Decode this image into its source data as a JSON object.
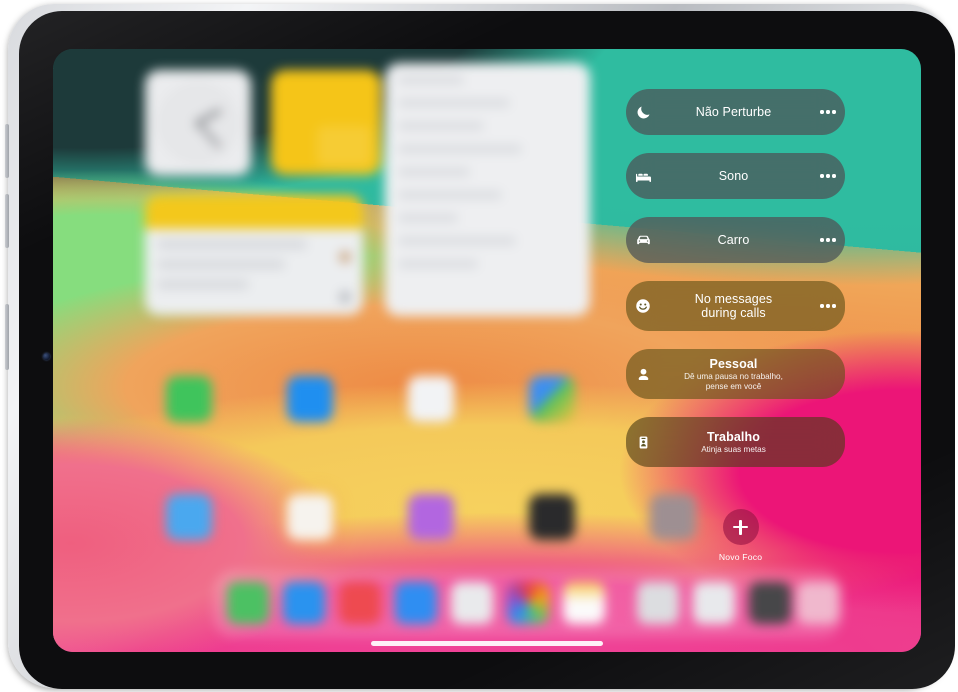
{
  "device": {
    "name": "iPad",
    "orientation": "landscape"
  },
  "focus_panel": {
    "items": [
      {
        "id": "do-not-disturb",
        "icon": "moon-icon",
        "title": "Não Perturbe",
        "subtitle": "",
        "has_more": true,
        "tint": "grey"
      },
      {
        "id": "sleep",
        "icon": "bed-icon",
        "title": "Sono",
        "subtitle": "",
        "has_more": true,
        "tint": "grey"
      },
      {
        "id": "driving",
        "icon": "car-icon",
        "title": "Carro",
        "subtitle": "",
        "has_more": true,
        "tint": "grey"
      },
      {
        "id": "no-messages-during-calls",
        "icon": "smiley-icon",
        "title": "No messages\nduring calls",
        "subtitle": "",
        "has_more": true,
        "tint": "olive"
      },
      {
        "id": "personal",
        "icon": "person-icon",
        "title": "Pessoal",
        "subtitle": "Dê uma pausa no trabalho,\npense em você",
        "has_more": false,
        "tint": "olive"
      },
      {
        "id": "work",
        "icon": "badge-icon",
        "title": "Trabalho",
        "subtitle": "Atinja suas metas",
        "has_more": false,
        "tint": "dark"
      }
    ],
    "new_focus": {
      "icon": "plus-icon",
      "label": "Novo Foco"
    }
  },
  "home_screen": {
    "widgets": [
      {
        "id": "clock-widget",
        "kind": "clock"
      },
      {
        "id": "yellow-widget",
        "kind": "solid"
      },
      {
        "id": "notes-widget",
        "kind": "notes"
      },
      {
        "id": "list-widget",
        "kind": "list"
      }
    ],
    "app_icons": [
      {
        "id": "app-1",
        "color": "#3fc45c"
      },
      {
        "id": "app-2",
        "color": "#1f8ff0"
      },
      {
        "id": "app-3",
        "color": "#f2f3f5"
      },
      {
        "id": "app-4",
        "color": "#3d8ff0"
      },
      {
        "id": "app-5",
        "color": "#4aa8ef"
      },
      {
        "id": "app-6",
        "color": "#f6f3ee"
      },
      {
        "id": "app-7",
        "color": "#b266e0"
      },
      {
        "id": "app-8",
        "color": "#2a2a2c"
      },
      {
        "id": "app-9",
        "color": "#9e8f92"
      }
    ],
    "dock_icons": [
      {
        "id": "dock-1",
        "color": "#4cc163"
      },
      {
        "id": "dock-2",
        "color": "#2a93ef"
      },
      {
        "id": "dock-3",
        "color": "#ee4a50"
      },
      {
        "id": "dock-4",
        "color": "#2f8ef2"
      },
      {
        "id": "dock-5",
        "color": "#e9eaec"
      },
      {
        "id": "dock-6",
        "color": "#f0f1f3"
      },
      {
        "id": "dock-7",
        "color": "#f7e9cf"
      },
      {
        "id": "dock-8",
        "color": "#dcdde0"
      },
      {
        "id": "dock-9",
        "color": "#e8e9ec"
      },
      {
        "id": "dock-10",
        "color": "#474749"
      },
      {
        "id": "dock-11",
        "color": "#f0b8cd"
      }
    ]
  },
  "colors": {
    "wallpaper_dark_teal": "#203f3e",
    "wallpaper_teal": "#2fbca0",
    "wallpaper_green": "#86dd7e",
    "wallpaper_orange": "#ee8b45",
    "wallpaper_gold": "#f4c95a",
    "wallpaper_magenta": "#ec1577",
    "wallpaper_pink": "#f07aa6",
    "card_text": "#ffffff"
  }
}
